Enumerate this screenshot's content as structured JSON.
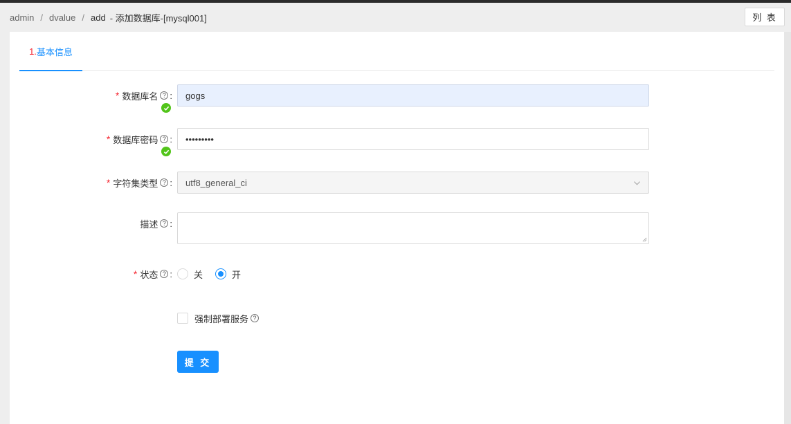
{
  "breadcrumb": {
    "items": [
      "admin",
      "dvalue",
      "add"
    ],
    "current": "-  添加数据库-[mysql001]"
  },
  "header": {
    "list_button": "列 表"
  },
  "tabs": [
    {
      "number": "1.",
      "label": "基本信息"
    }
  ],
  "form": {
    "db_name": {
      "label": "数据库名",
      "value": "gogs",
      "required": true,
      "valid": true
    },
    "db_password": {
      "label": "数据库密码",
      "value": "•••••••••",
      "required": true,
      "valid": true
    },
    "charset": {
      "label": "字符集类型",
      "value": "utf8_general_ci",
      "required": true
    },
    "description": {
      "label": "描述",
      "value": ""
    },
    "status": {
      "label": "状态",
      "options": [
        "关",
        "开"
      ],
      "selected": "开",
      "required": true
    },
    "force_deploy": {
      "label": "强制部署服务",
      "checked": false
    },
    "submit_label": "提 交"
  },
  "symbols": {
    "required_mark": "*",
    "help": "?",
    "colon": ":"
  },
  "colors": {
    "accent": "#1890ff",
    "success": "#52c41a",
    "required": "#f5222d"
  }
}
